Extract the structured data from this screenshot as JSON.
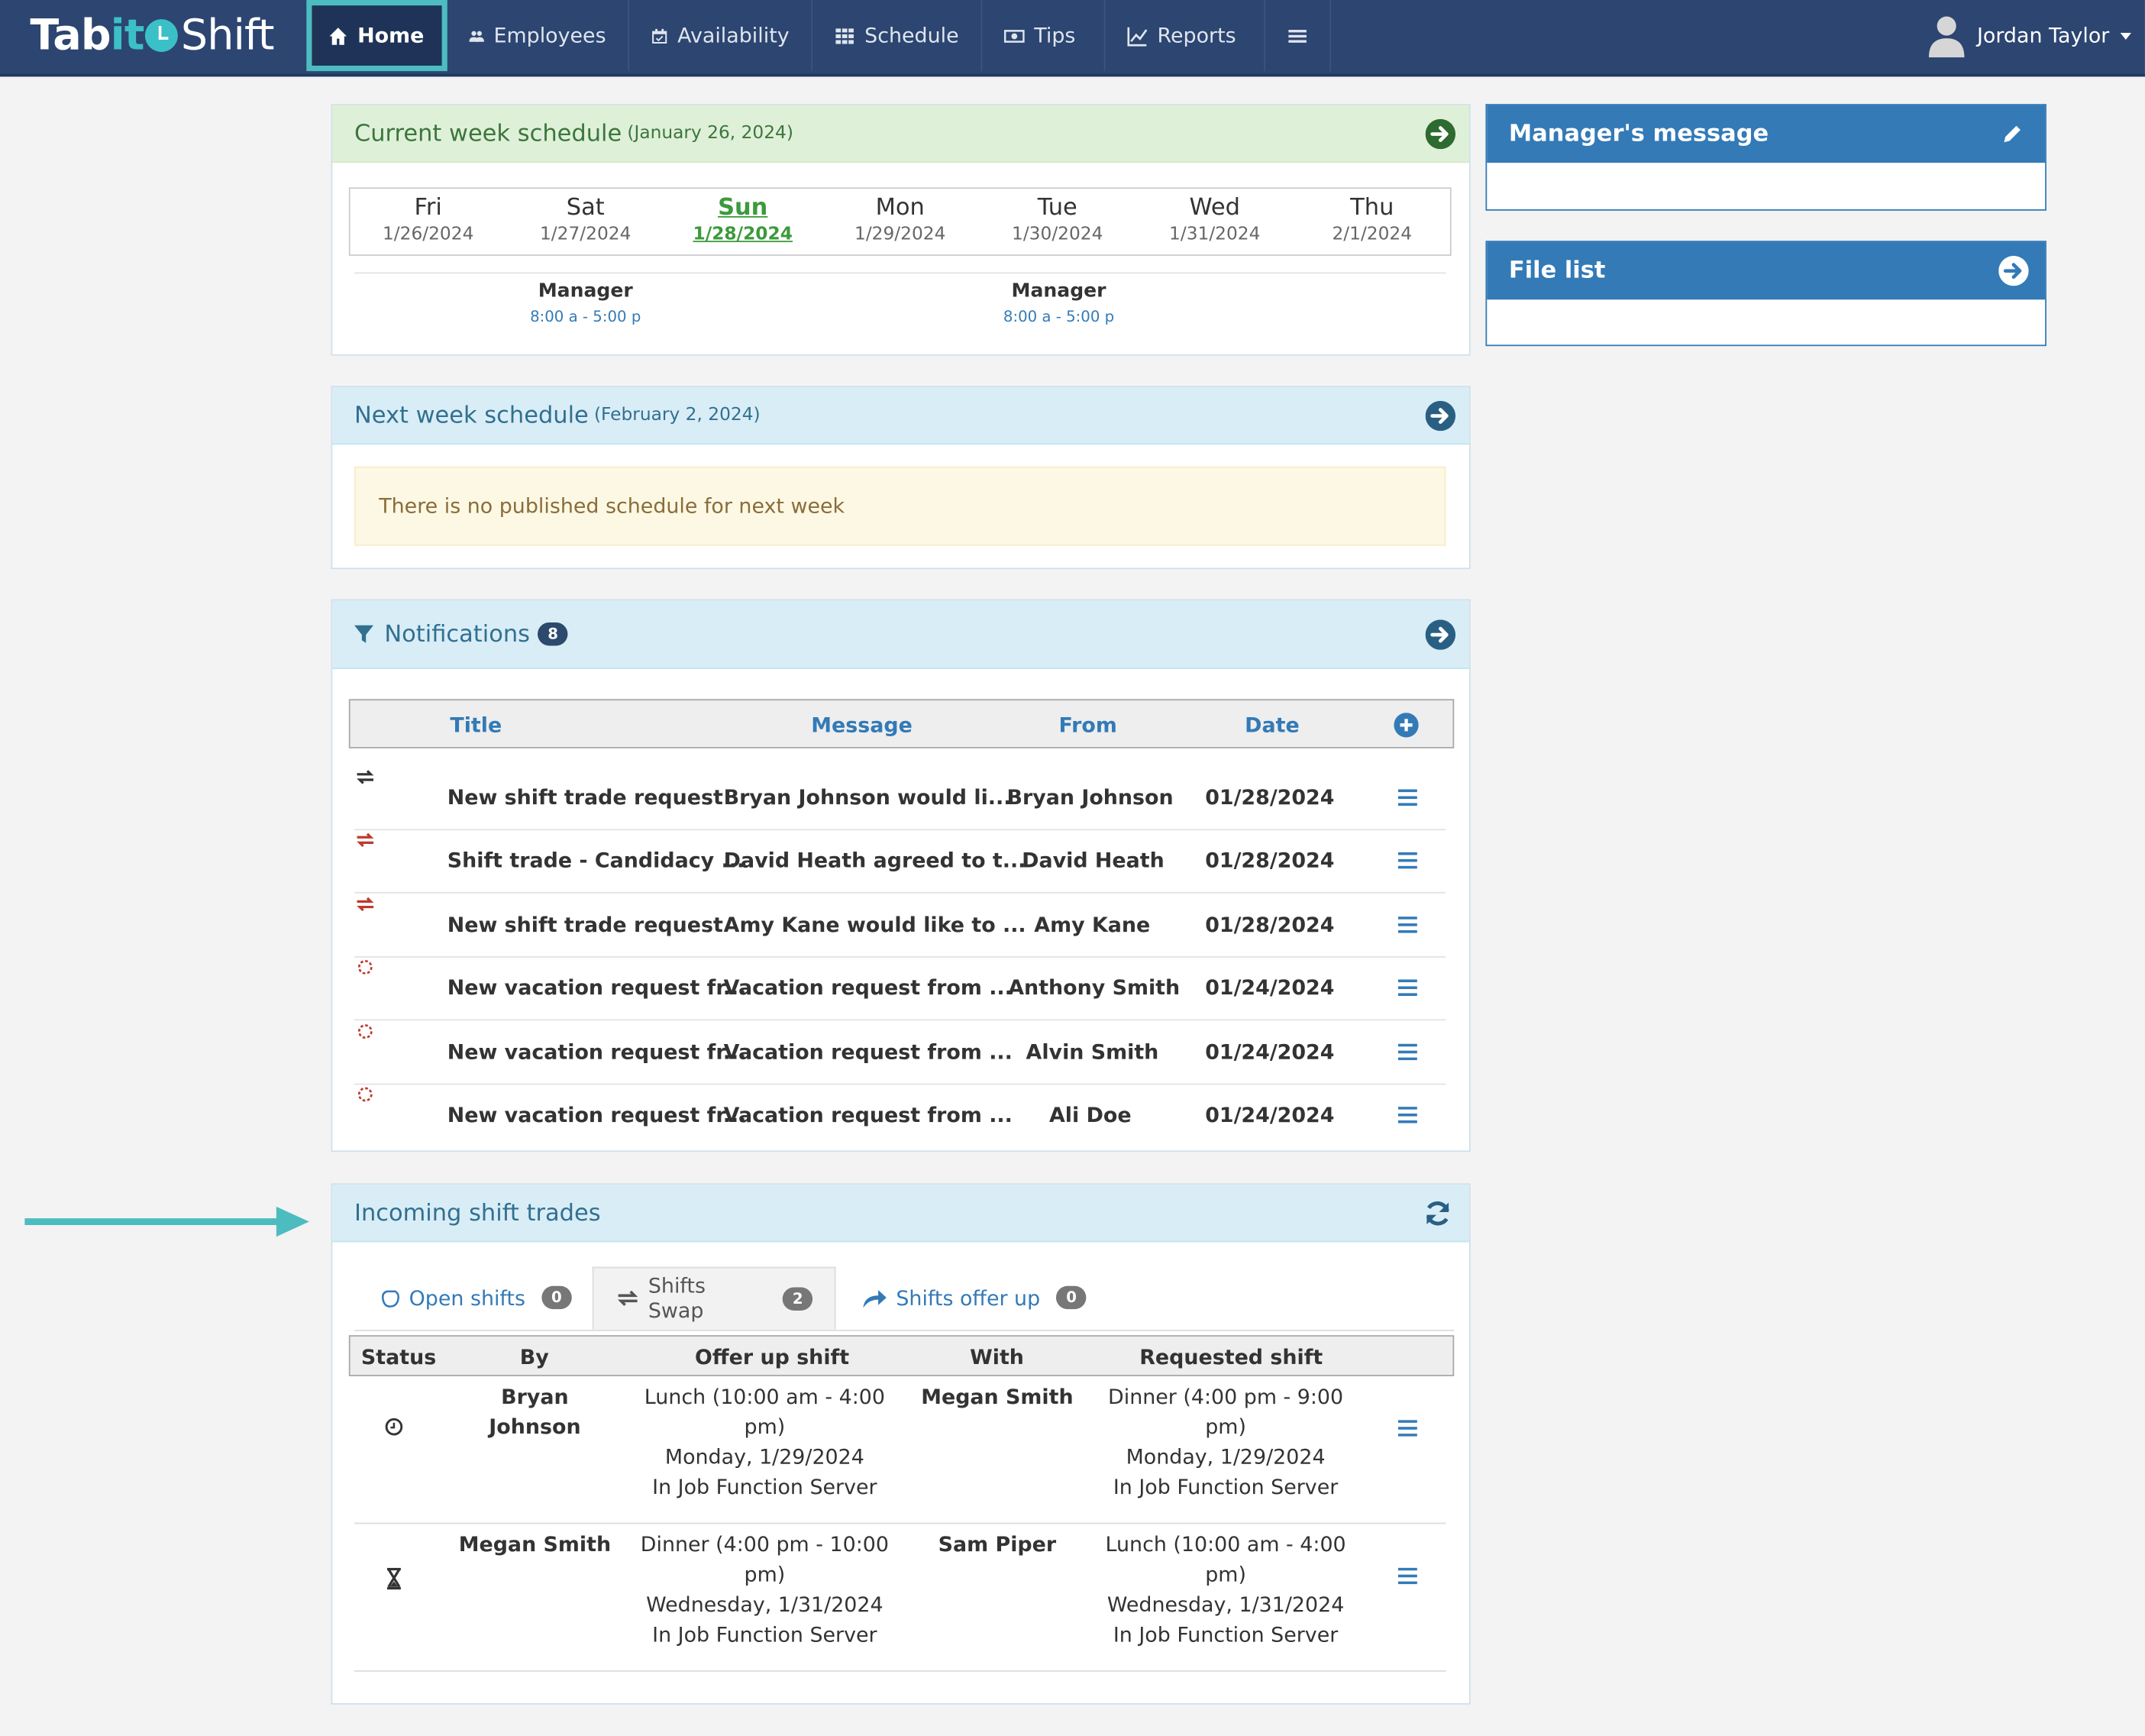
{
  "nav": {
    "brand": {
      "tab": "Tab",
      "it": "it",
      "shift": "Shift"
    },
    "items": [
      {
        "label": "Home",
        "icon": "home-icon"
      },
      {
        "label": "Employees",
        "icon": "users-icon"
      },
      {
        "label": "Availability",
        "icon": "calendar-icon"
      },
      {
        "label": "Schedule",
        "icon": "grid-icon"
      },
      {
        "label": "Tips",
        "icon": "money-icon"
      },
      {
        "label": "Reports",
        "icon": "line-chart-icon"
      }
    ],
    "user_name": "Jordan Taylor"
  },
  "current_week": {
    "title": "Current week schedule",
    "date": "(January 26, 2024)",
    "days": [
      {
        "name": "Fri",
        "date": "1/26/2024"
      },
      {
        "name": "Sat",
        "date": "1/27/2024"
      },
      {
        "name": "Sun",
        "date": "1/28/2024"
      },
      {
        "name": "Mon",
        "date": "1/29/2024"
      },
      {
        "name": "Tue",
        "date": "1/30/2024"
      },
      {
        "name": "Wed",
        "date": "1/31/2024"
      },
      {
        "name": "Thu",
        "date": "2/1/2024"
      }
    ],
    "shifts": [
      {
        "role": "Manager",
        "hours": "8:00 a - 5:00 p"
      },
      {
        "role": "Manager",
        "hours": "8:00 a - 5:00 p"
      }
    ]
  },
  "next_week": {
    "title": "Next week schedule",
    "date": "(February 2, 2024)",
    "message": "There is no published schedule for next week"
  },
  "notifications": {
    "title": "Notifications",
    "count": "8",
    "columns": {
      "title": "Title",
      "message": "Message",
      "from": "From",
      "date": "Date"
    },
    "rows": [
      {
        "title": "New shift trade request",
        "message": "Bryan Johnson would li...",
        "from": "Bryan Johnson",
        "date": "01/28/2024",
        "icon": "swap-icon"
      },
      {
        "title": "Shift trade - Candidacy ...",
        "message": "David Heath agreed to t...",
        "from": "David Heath",
        "date": "01/28/2024",
        "icon": "swap-icon"
      },
      {
        "title": "New shift trade request",
        "message": "Amy Kane would like to ...",
        "from": "Amy Kane",
        "date": "01/28/2024",
        "icon": "swap-icon"
      },
      {
        "title": "New vacation request fr...",
        "message": "Vacation request from ...",
        "from": "Anthony Smith",
        "date": "01/24/2024",
        "icon": "sun-icon"
      },
      {
        "title": "New vacation request fr...",
        "message": "Vacation request from ...",
        "from": "Alvin Smith",
        "date": "01/24/2024",
        "icon": "sun-icon"
      },
      {
        "title": "New vacation request fr...",
        "message": "Vacation request from ...",
        "from": "Ali Doe",
        "date": "01/24/2024",
        "icon": "sun-icon"
      }
    ]
  },
  "shift_trades": {
    "title": "Incoming shift trades",
    "tabs": [
      {
        "label": "Open shifts",
        "count": "0"
      },
      {
        "label": "Shifts Swap",
        "count": "2"
      },
      {
        "label": "Shifts offer up",
        "count": "0"
      }
    ],
    "columns": {
      "status": "Status",
      "by": "By",
      "offer": "Offer up shift",
      "with": "With",
      "requested": "Requested shift"
    },
    "rows": [
      {
        "status_icon": "clock-icon",
        "by": "Bryan Johnson",
        "offer": [
          "Lunch (10:00 am - 4:00",
          "pm)",
          "Monday, 1/29/2024",
          "In Job Function Server"
        ],
        "with": "Megan Smith",
        "requested": [
          "Dinner (4:00 pm - 9:00",
          "pm)",
          "Monday, 1/29/2024",
          "In Job Function Server"
        ]
      },
      {
        "status_icon": "hourglass-icon",
        "by": "Megan Smith",
        "offer": [
          "Dinner (4:00 pm - 10:00",
          "pm)",
          "Wednesday, 1/31/2024",
          "In Job Function Server"
        ],
        "with": "Sam Piper",
        "requested": [
          "Lunch (10:00 am - 4:00",
          "pm)",
          "Wednesday, 1/31/2024",
          "In Job Function Server"
        ]
      }
    ]
  },
  "managers_message": {
    "title": "Manager's message"
  },
  "file_list": {
    "title": "File list"
  },
  "colors": {
    "navbar": "#2c4571",
    "accent": "#4dbcc0",
    "link": "#337ab7",
    "today": "#3c9a3c"
  }
}
